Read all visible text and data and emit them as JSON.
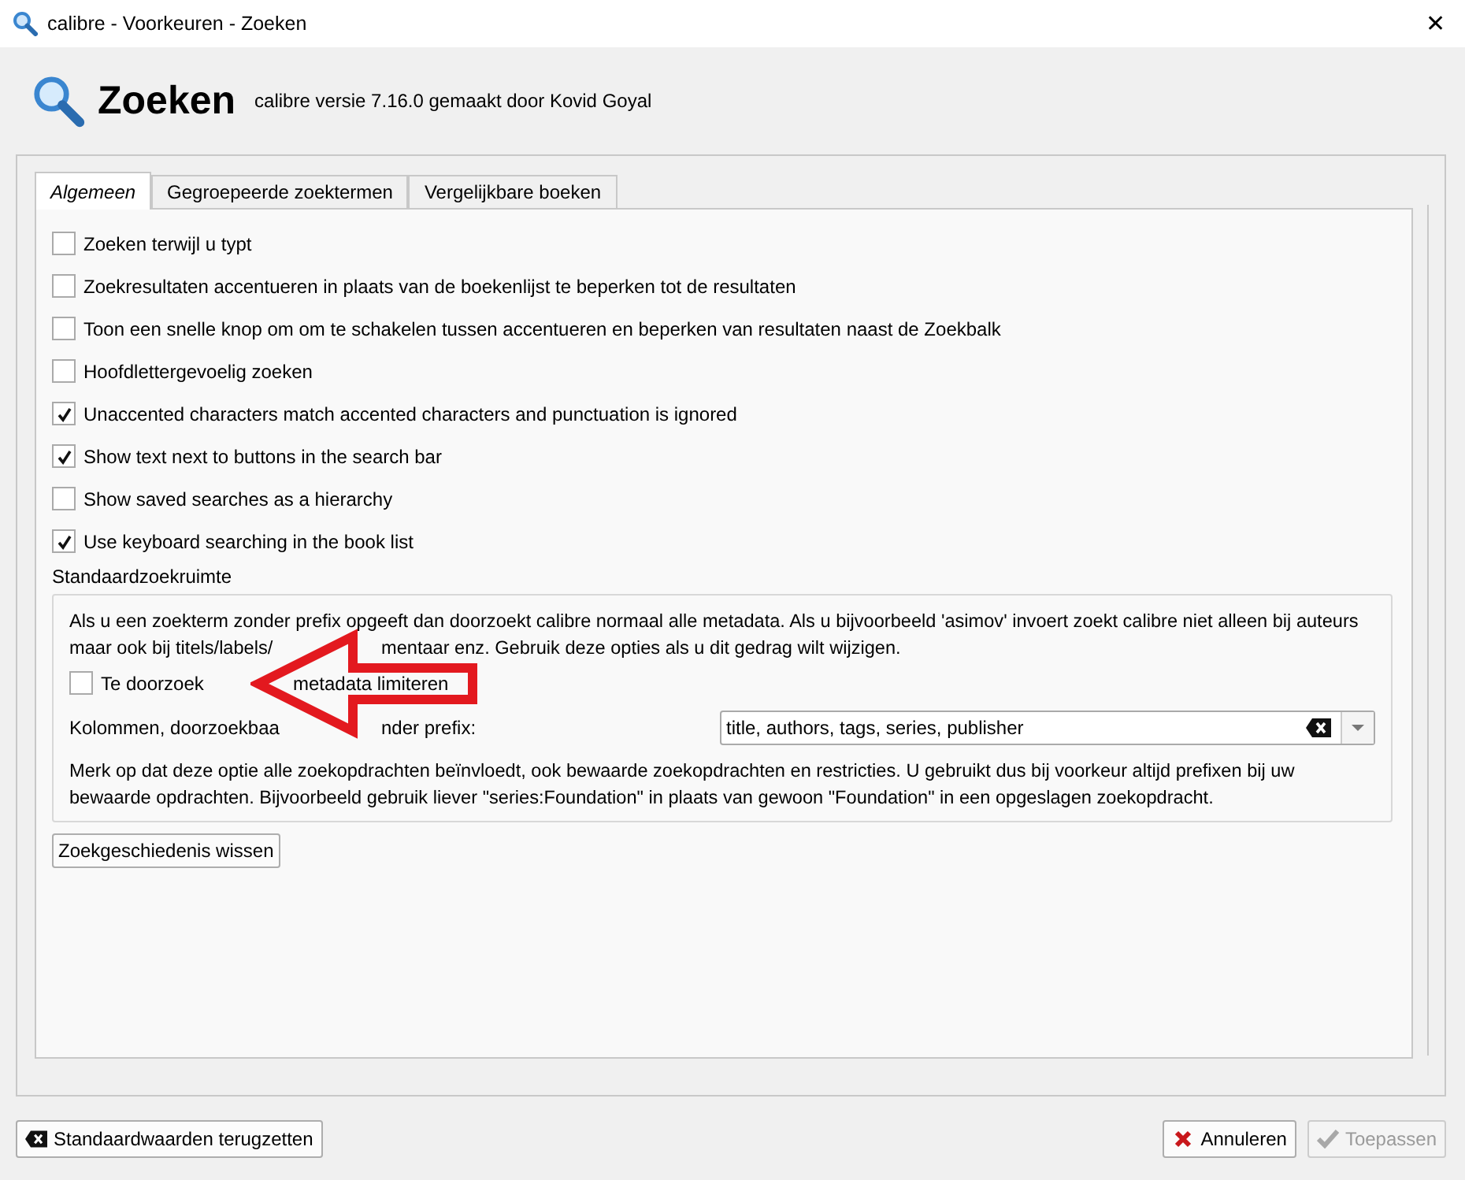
{
  "window": {
    "title": "calibre - Voorkeuren - Zoeken",
    "close": "✕"
  },
  "header": {
    "title": "Zoeken",
    "subtitle": "calibre versie 7.16.0 gemaakt door Kovid Goyal"
  },
  "tabs": [
    {
      "label": "Algemeen",
      "selected": true
    },
    {
      "label": "Gegroepeerde zoektermen",
      "selected": false
    },
    {
      "label": "Vergelijkbare boeken",
      "selected": false
    }
  ],
  "options": [
    {
      "label": "Zoeken terwijl u typt",
      "checked": false
    },
    {
      "label": "Zoekresultaten accentueren in plaats van de boekenlijst te beperken tot de resultaten",
      "checked": false
    },
    {
      "label": "Toon een snelle knop om om te schakelen tussen accentueren en beperken van resultaten naast de Zoekbalk",
      "checked": false
    },
    {
      "label": "Hoofdlettergevoelig zoeken",
      "checked": false
    },
    {
      "label": "Unaccented characters match accented characters and punctuation is ignored",
      "checked": true
    },
    {
      "label": "Show text next to buttons in the search bar",
      "checked": true
    },
    {
      "label": "Show saved searches as a hierarchy",
      "checked": false
    },
    {
      "label": "Use keyboard searching in the book list",
      "checked": true
    }
  ],
  "scope": {
    "title": "Standaardzoekruimte",
    "intro": [
      "Als u een zoekterm zonder prefix opgeeft dan doorzoekt calibre normaal alle metadata. Als u bijvoorbeeld 'asimov' invoert zoekt calibre niet alleen bij auteurs",
      "maar ook bij titels/labels/",
      "mentaar enz. Gebruik deze opties als u dit gedrag wilt wijzigen."
    ],
    "limit": {
      "label": [
        "Te doorzoek",
        "metadata limiteren"
      ],
      "checked": false
    },
    "columns_label": [
      "Kolommen, doorzoekbaa",
      "nder prefix:"
    ],
    "columns_value": "title, authors, tags, series, publisher",
    "note": "Merk op dat deze optie alle zoekopdrachten beïnvloedt, ook bewaarde zoekopdrachten en restricties. U gebruikt dus bij voorkeur altijd prefixen bij uw bewaarde opdrachten. Bijvoorbeeld gebruik liever \"series:Foundation\" in plaats van gewoon \"Foundation\" in een opgeslagen zoekopdracht."
  },
  "clear_history": "Zoekgeschiedenis wissen",
  "footer": {
    "restore": "Standaardwaarden terugzetten",
    "cancel": {
      "label": "Annuleren",
      "disabled": false
    },
    "apply": {
      "label": "Toepassen",
      "disabled": true
    }
  }
}
